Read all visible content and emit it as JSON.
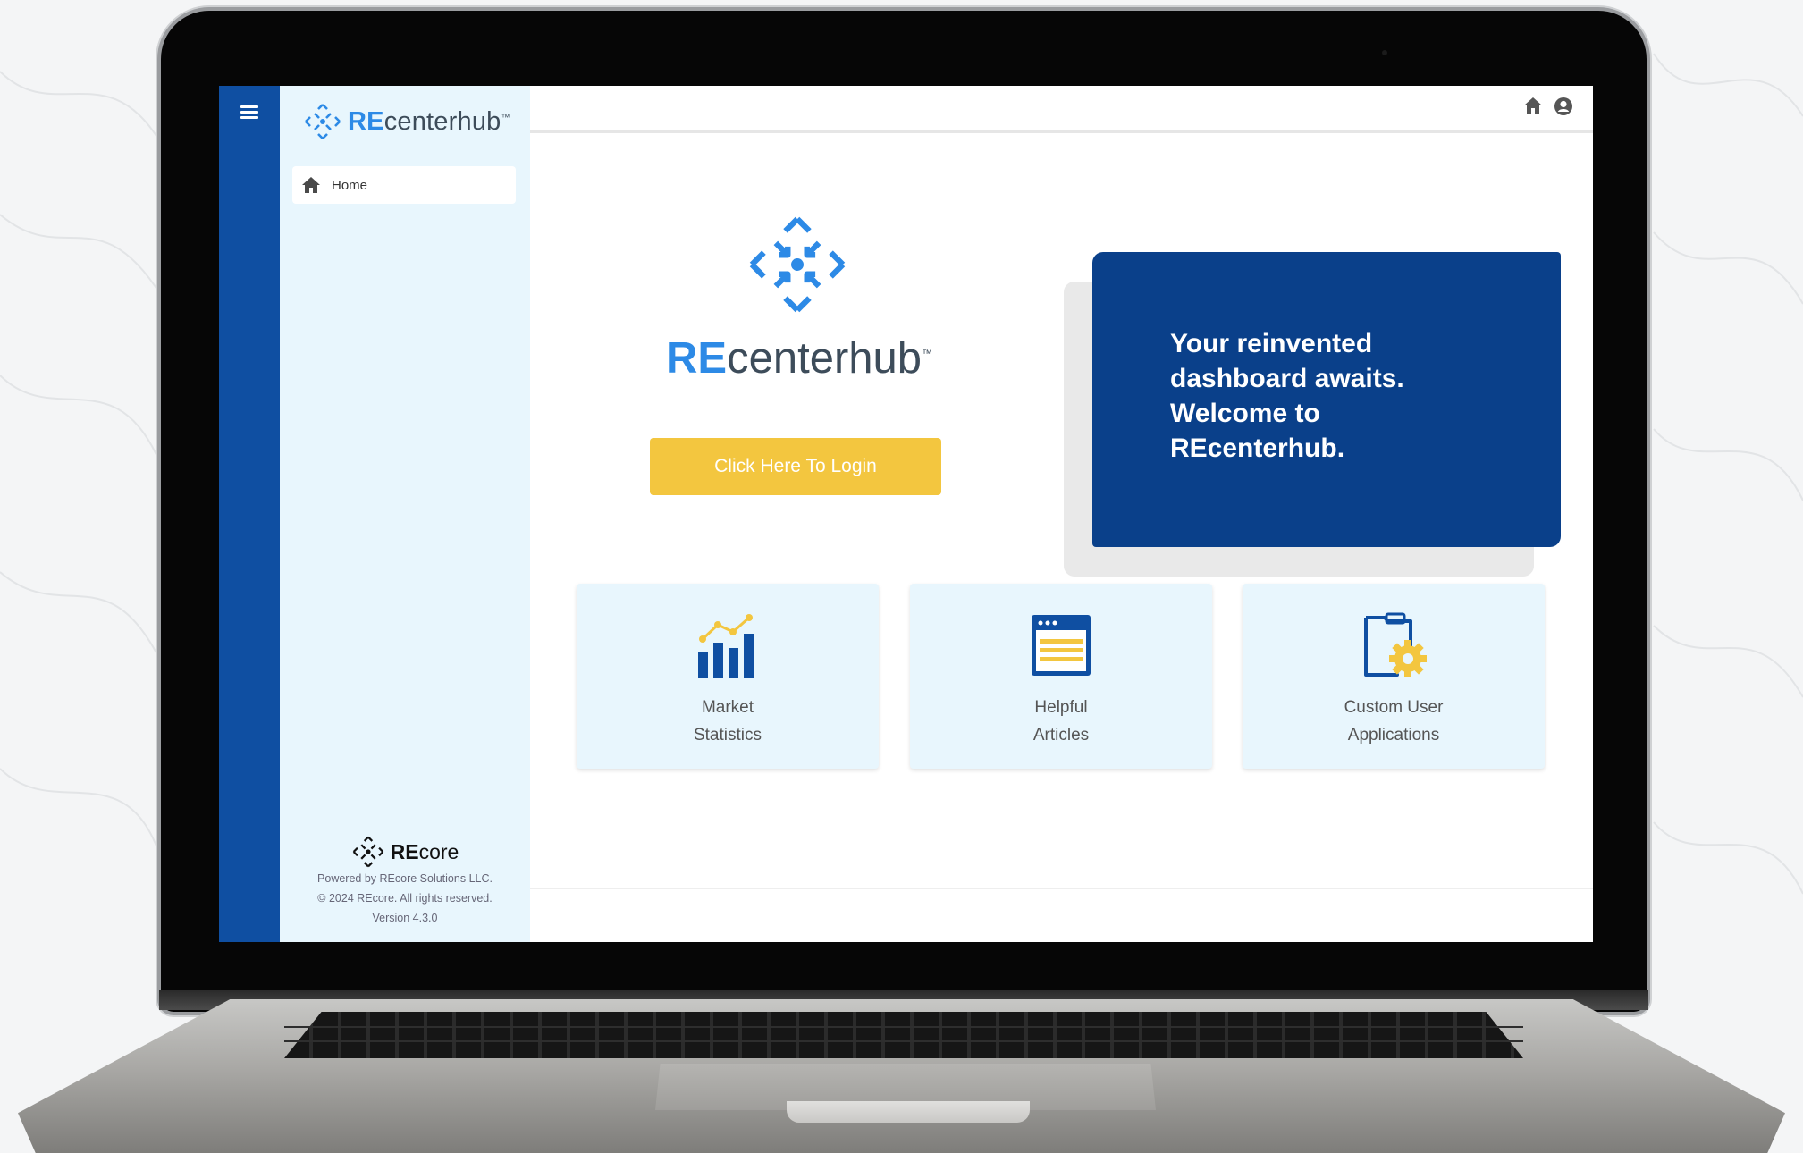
{
  "brand": {
    "re": "RE",
    "rest": "centerhub",
    "tm": "™"
  },
  "sidebar": {
    "menu_icon": "hamburger-icon",
    "items": [
      {
        "label": "Home",
        "icon": "home-icon"
      }
    ],
    "footer": {
      "logo_re": "RE",
      "logo_rest": "core",
      "powered": "Powered by REcore Solutions LLC.",
      "copyright": "© 2024 REcore. All rights reserved.",
      "version": "Version 4.3.0"
    }
  },
  "topbar": {
    "icons": [
      "home-icon",
      "user-circle-icon"
    ]
  },
  "hero": {
    "re": "RE",
    "rest": "centerhub",
    "tm": "™",
    "login_label": "Click Here To Login"
  },
  "welcome": {
    "line1": "Your reinvented",
    "line2": "dashboard awaits.",
    "line3": "Welcome to",
    "line4": "REcenterhub."
  },
  "cards": [
    {
      "line1": "Market",
      "line2": "Statistics",
      "icon": "bar-chart-icon"
    },
    {
      "line1": "Helpful",
      "line2": "Articles",
      "icon": "article-icon"
    },
    {
      "line1": "Custom User",
      "line2": "Applications",
      "icon": "gear-document-icon"
    }
  ],
  "colors": {
    "primary": "#0f4fa2",
    "accent": "#2d8ae6",
    "cta": "#f3c63f",
    "panel": "#0a408a",
    "sidebar_bg": "#e8f6fd"
  }
}
